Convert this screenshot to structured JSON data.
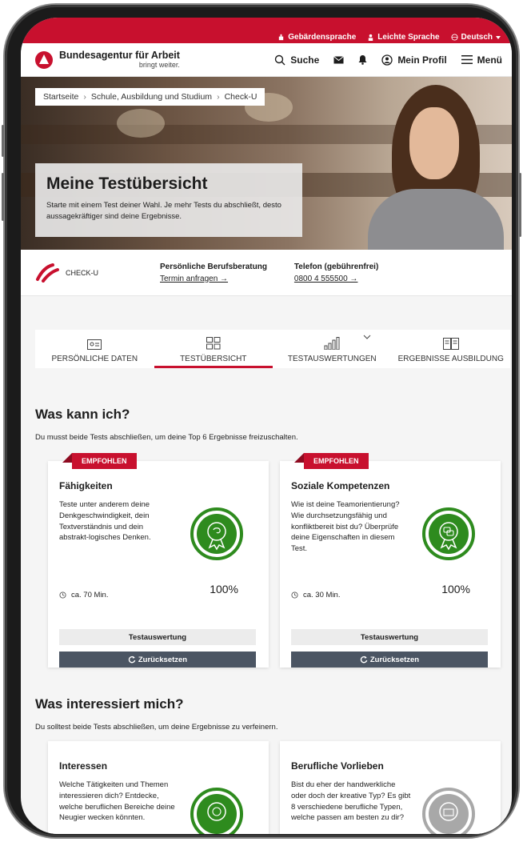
{
  "topbar": {
    "sign_language": "Gebärdensprache",
    "easy_language": "Leichte Sprache",
    "language": "Deutsch"
  },
  "header": {
    "brand_title": "Bundesagentur für Arbeit",
    "brand_sub": "bringt weiter.",
    "search": "Suche",
    "profile": "Mein Profil",
    "menu": "Menü"
  },
  "breadcrumb": [
    "Startseite",
    "Schule, Ausbildung und Studium",
    "Check-U"
  ],
  "hero": {
    "title": "Meine Testübersicht",
    "text": "Starte mit einem Test deiner Wahl. Je mehr Tests du abschließt, desto aussagekräftiger sind deine Ergebnisse."
  },
  "strip": {
    "logo_text": "CHECK-U",
    "consult_title": "Persönliche Berufsberatung",
    "consult_link": "Termin anfragen →",
    "phone_title": "Telefon (gebührenfrei)",
    "phone_link": "0800 4 555500 →"
  },
  "tabs": [
    {
      "label": "PERSÖNLICHE DATEN",
      "icon": "id-card-icon"
    },
    {
      "label": "TESTÜBERSICHT",
      "icon": "dashboard-icon",
      "active": true
    },
    {
      "label": "TESTAUSWERTUNGEN",
      "icon": "bar-chart-icon"
    },
    {
      "label": "ERGEBNISSE AUSBILDUNG",
      "icon": "book-icon"
    }
  ],
  "section1": {
    "title": "Was kann ich?",
    "desc": "Du musst beide Tests abschließen, um deine Top 6 Ergebnisse freizuschalten."
  },
  "section2": {
    "title": "Was interessiert mich?",
    "desc": "Du solltest beide Tests abschließen, um deine Ergebnisse zu verfeinern."
  },
  "cards": [
    {
      "badge": "EMPFOHLEN",
      "title": "Fähigkeiten",
      "desc": "Teste unter anderem deine Denkgeschwindigkeit, dein Textverständnis und dein abstrakt-logisches Denken.",
      "duration": "ca. 70 Min.",
      "percent": "100%",
      "btn_eval": "Testauswertung",
      "btn_reset": "Zurücksetzen"
    },
    {
      "badge": "EMPFOHLEN",
      "title": "Soziale Kompetenzen",
      "desc": "Wie ist deine Teamorientierung? Wie durchsetzungsfähig und konfliktbereit bist du? Überprüfe deine Eigenschaften in diesem Test.",
      "duration": "ca. 30 Min.",
      "percent": "100%",
      "btn_eval": "Testauswertung",
      "btn_reset": "Zurücksetzen"
    },
    {
      "title": "Interessen",
      "desc": "Welche Tätigkeiten und Themen interessieren dich? Entdecke, welche beruflichen Bereiche deine Neugier wecken könnten."
    },
    {
      "title": "Berufliche Vorlieben",
      "desc": "Bist du eher der handwerkliche oder doch der kreative Typ? Es gibt 8 verschiedene berufliche Typen, welche passen am besten zu dir?"
    }
  ],
  "colors": {
    "brand_red": "#c8102e",
    "medal_green": "#2e8b1e",
    "medal_gray": "#a8a8a8",
    "button_dark": "#4b5563"
  }
}
